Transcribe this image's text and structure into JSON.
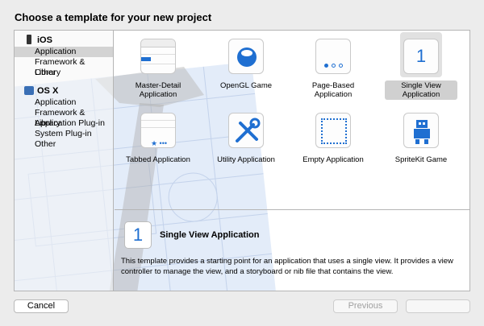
{
  "dialog": {
    "title": "Choose a template for your new project"
  },
  "sidebar": {
    "groups": [
      {
        "label": "iOS",
        "icon": "iphone-icon",
        "items": [
          "Application",
          "Framework & Library",
          "Other"
        ]
      },
      {
        "label": "OS X",
        "icon": "os-x-icon",
        "items": [
          "Application",
          "Framework & Library",
          "Application Plug-in",
          "System Plug-in",
          "Other"
        ]
      }
    ],
    "selected": "iOS / Application"
  },
  "templates": [
    {
      "label": "Master-Detail Application",
      "icon": "master-detail-icon"
    },
    {
      "label": "OpenGL Game",
      "icon": "opengl-icon"
    },
    {
      "label": "Page-Based Application",
      "icon": "page-dots-icon"
    },
    {
      "label": "Single View Application",
      "icon": "single-view-icon",
      "glyph": "1",
      "selected": true
    },
    {
      "label": "Tabbed Application",
      "icon": "tab-bar-icon",
      "glyph": "★ •••"
    },
    {
      "label": "Utility Application",
      "icon": "tools-icon"
    },
    {
      "label": "Empty Application",
      "icon": "empty-frame-icon"
    },
    {
      "label": "SpriteKit Game",
      "icon": "sprite-robot-icon"
    }
  ],
  "detail": {
    "glyph": "1",
    "title": "Single View Application",
    "description": "This template provides a starting point for an application that uses a single view. It provides a view controller to manage the view, and a storyboard or nib file that contains the view."
  },
  "buttons": {
    "cancel": "Cancel",
    "previous": "Previous",
    "next": ""
  },
  "colors": {
    "accent": "#1f6fd1",
    "selection": "#d3d3d3",
    "blueprint": "#dfe9f8"
  }
}
